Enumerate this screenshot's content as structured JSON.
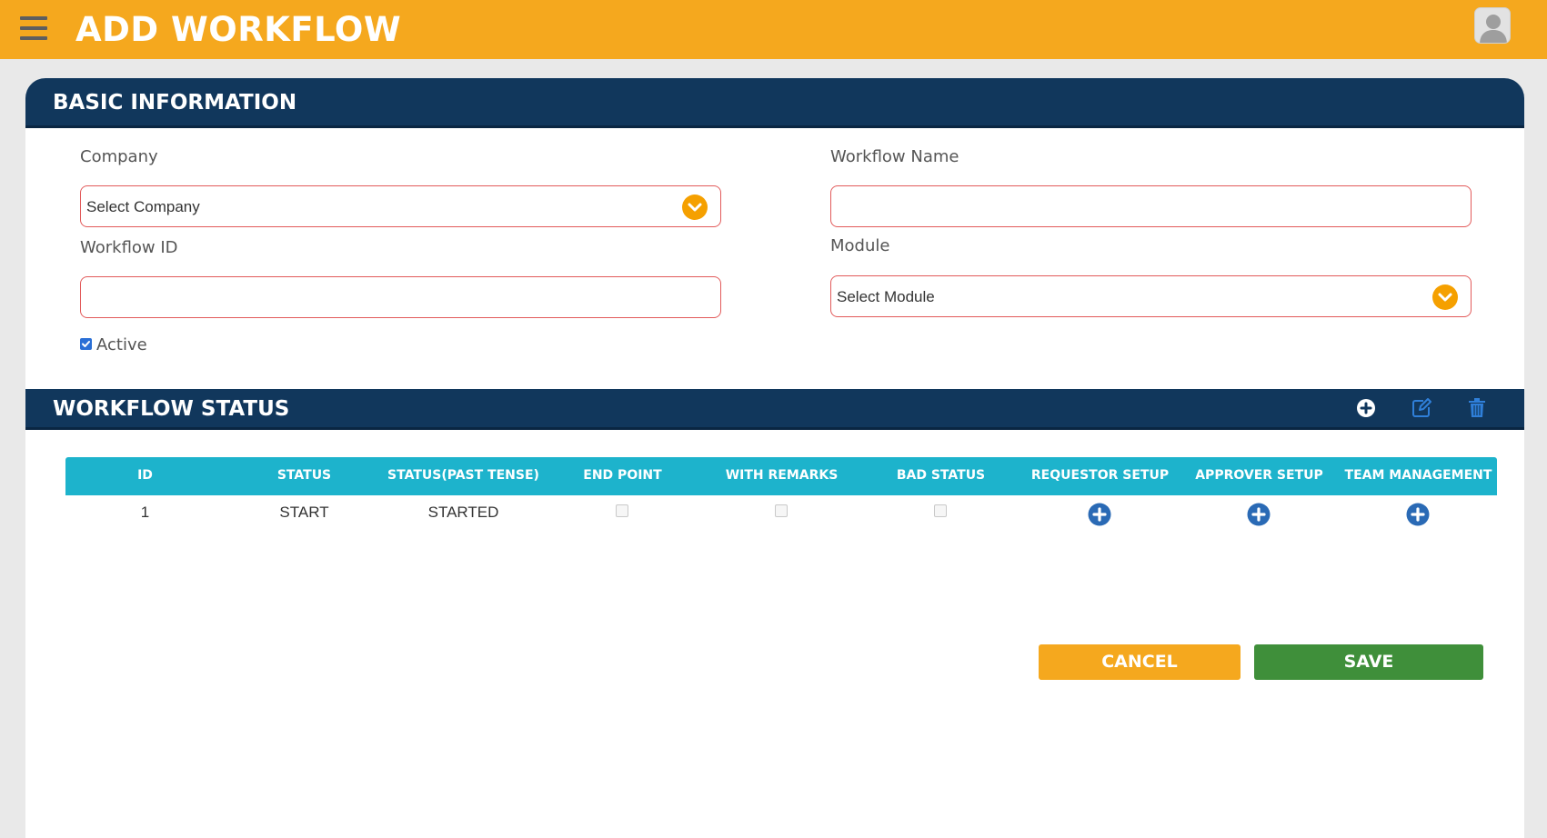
{
  "header": {
    "title": "ADD WORKFLOW"
  },
  "basic_info": {
    "title": "BASIC INFORMATION",
    "company": {
      "label": "Company",
      "value": "Select Company"
    },
    "workflow_name": {
      "label": "Workflow Name",
      "value": ""
    },
    "workflow_id": {
      "label": "Workflow ID",
      "value": ""
    },
    "module": {
      "label": "Module",
      "value": "Select Module"
    },
    "active": {
      "label": "Active",
      "checked": true
    }
  },
  "workflow_status": {
    "title": "WORKFLOW STATUS",
    "columns": [
      "ID",
      "STATUS",
      "STATUS(PAST TENSE)",
      "END POINT",
      "WITH REMARKS",
      "BAD STATUS",
      "REQUESTOR SETUP",
      "APPROVER SETUP",
      "TEAM MANAGEMENT"
    ],
    "rows": [
      {
        "id": "1",
        "status": "START",
        "past_tense": "STARTED",
        "end_point": false,
        "with_remarks": false,
        "bad_status": false
      }
    ]
  },
  "actions": {
    "cancel": "CANCEL",
    "save": "SAVE"
  },
  "colors": {
    "topbar": "#f5a81e",
    "section_header": "#11375c",
    "table_header": "#1db3cc",
    "save": "#3f8f3a",
    "cancel": "#f5a81e"
  }
}
